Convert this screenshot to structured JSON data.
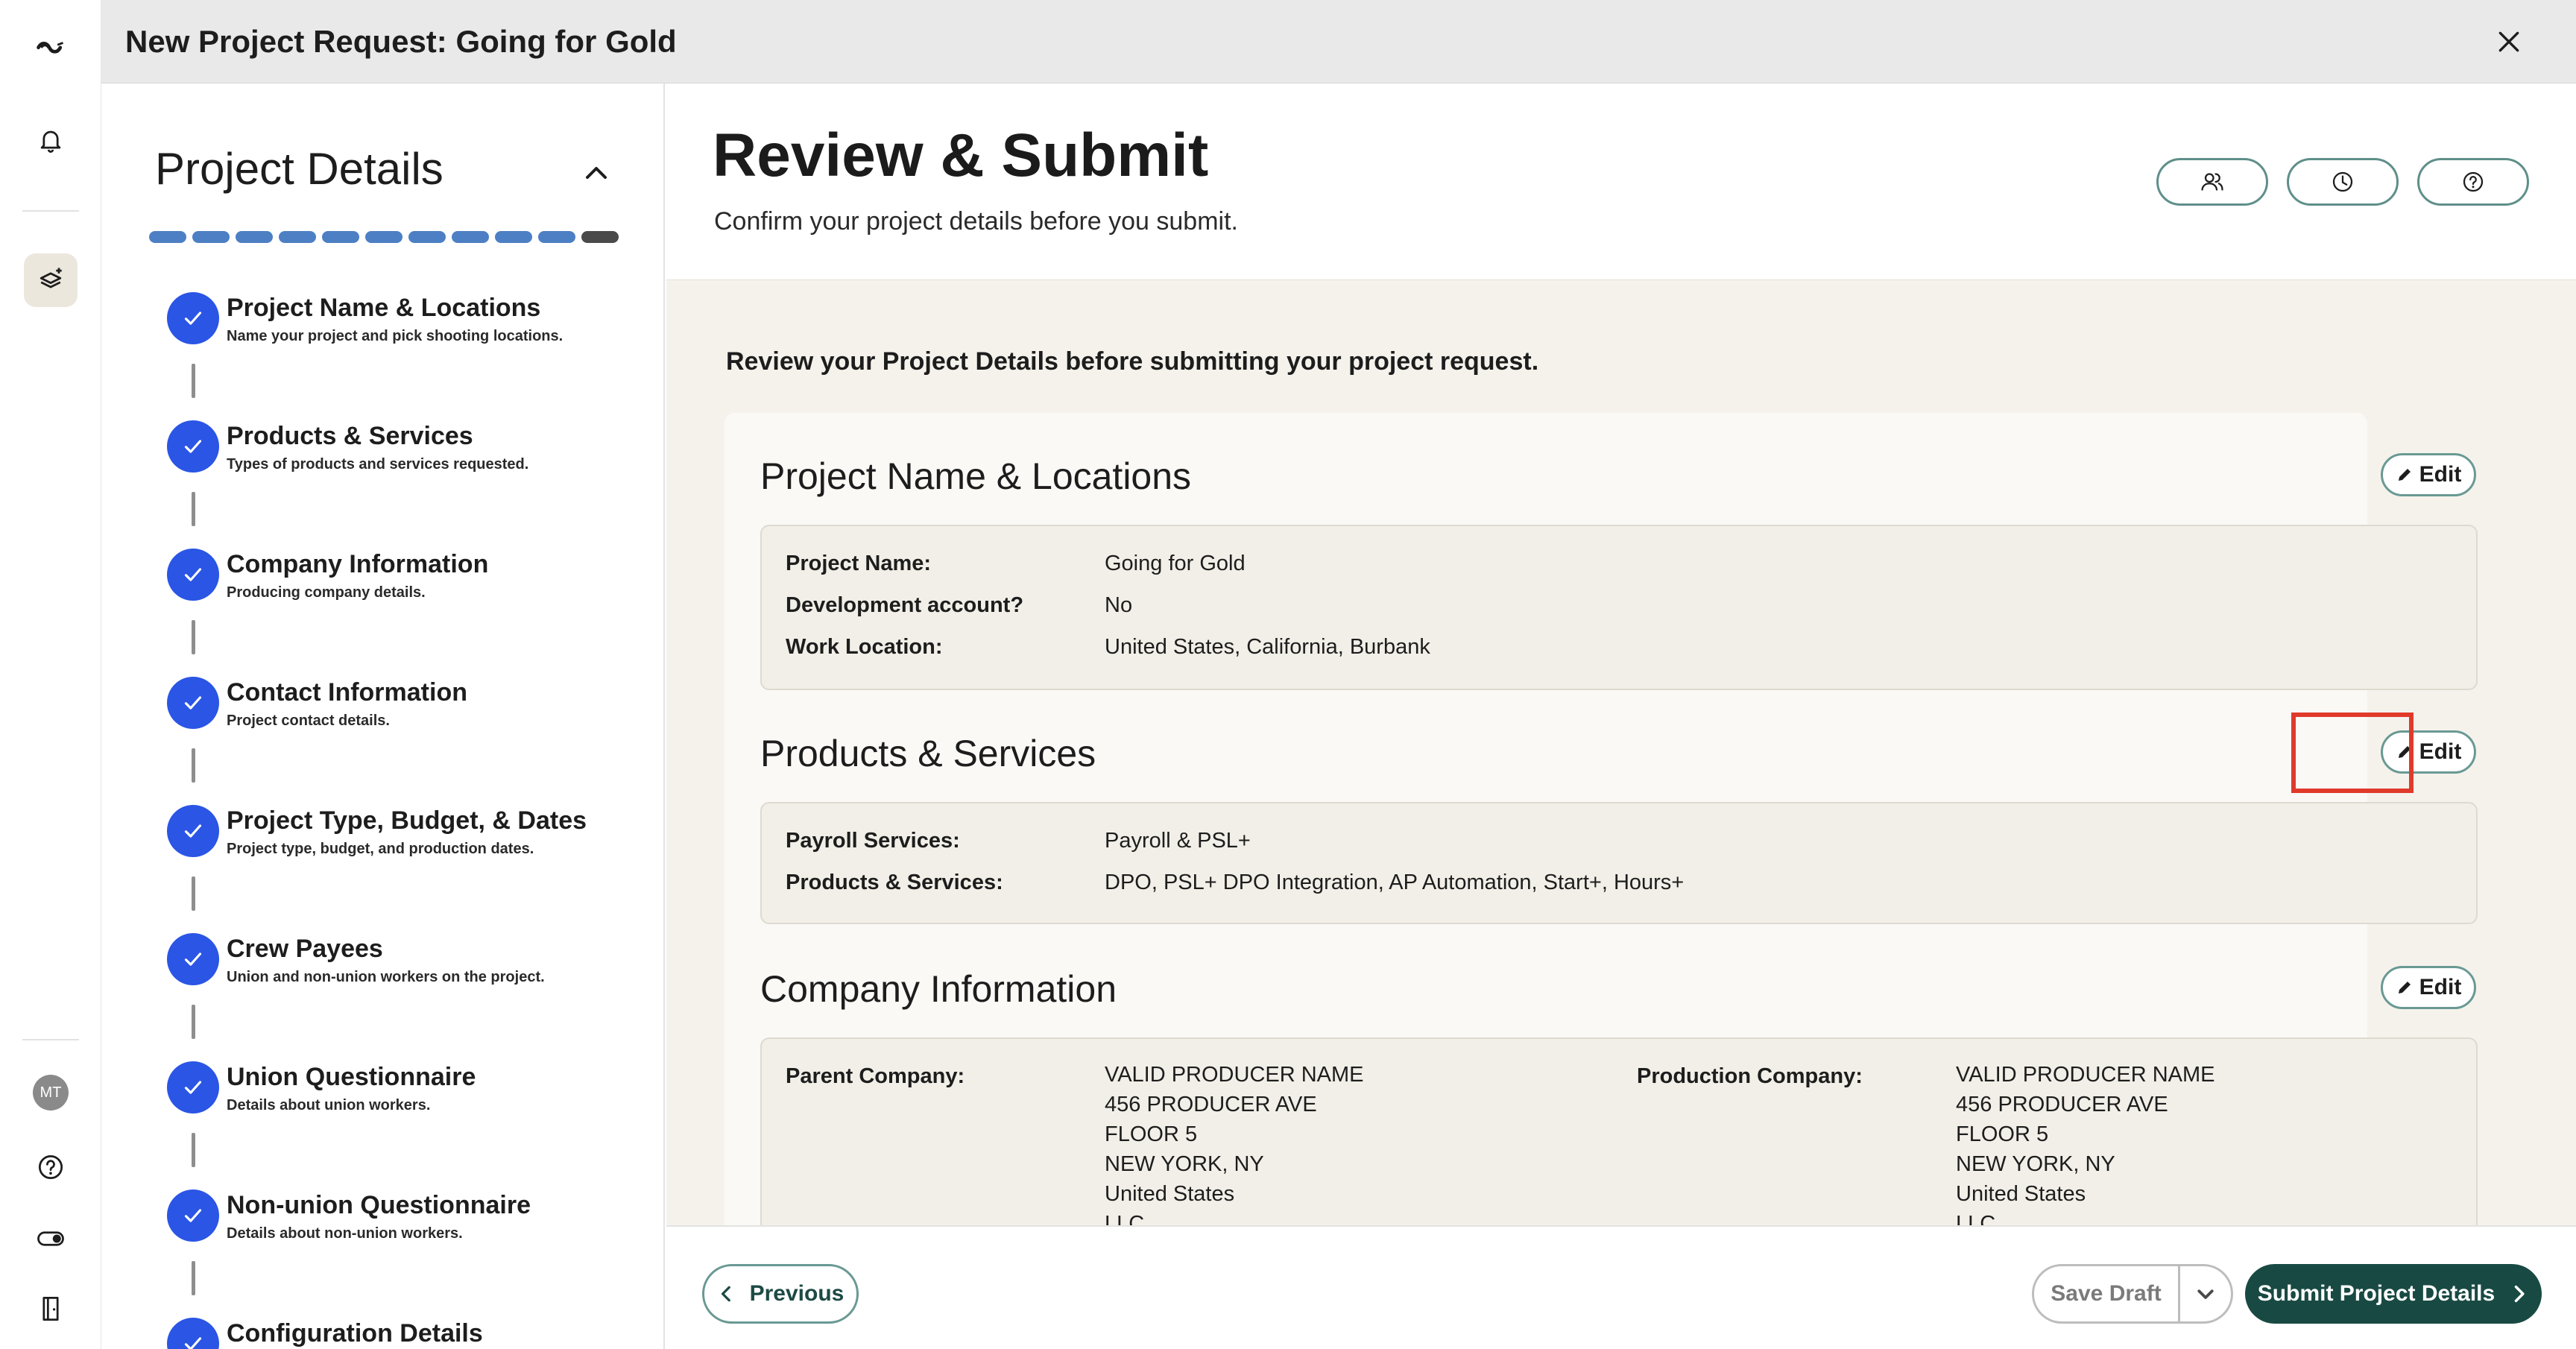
{
  "window": {
    "title": "New Project Request: Going for Gold"
  },
  "rail": {
    "avatar_initials": "MT"
  },
  "sidebar": {
    "heading": "Project Details",
    "steps": [
      {
        "label": "Project Name & Locations",
        "desc": "Name your project and pick shooting locations."
      },
      {
        "label": "Products & Services",
        "desc": "Types of products and services requested."
      },
      {
        "label": "Company Information",
        "desc": "Producing company details."
      },
      {
        "label": "Contact Information",
        "desc": "Project contact details."
      },
      {
        "label": "Project Type, Budget, & Dates",
        "desc": "Project type, budget, and production dates."
      },
      {
        "label": "Crew Payees",
        "desc": "Union and non-union workers on the project."
      },
      {
        "label": "Union Questionnaire",
        "desc": "Details about union workers."
      },
      {
        "label": "Non-union Questionnaire",
        "desc": "Details about non-union workers."
      },
      {
        "label": "Configuration Details",
        "desc": ""
      }
    ]
  },
  "main": {
    "title": "Review & Submit",
    "subtitle": "Confirm your project details before you submit.",
    "intro": "Review your Project Details before submitting your project request.",
    "edit_label": "Edit",
    "sections": {
      "project": {
        "title": "Project Name & Locations",
        "rows": [
          {
            "k": "Project Name:",
            "v": "Going for Gold"
          },
          {
            "k": "Development account?",
            "v": "No"
          },
          {
            "k": "Work Location:",
            "v": "United States, California, Burbank"
          }
        ]
      },
      "products": {
        "title": "Products & Services",
        "rows": [
          {
            "k": "Payroll Services:",
            "v": "Payroll & PSL+"
          },
          {
            "k": "Products & Services:",
            "v": "DPO, PSL+ DPO Integration, AP Automation, Start+, Hours+"
          }
        ]
      },
      "company": {
        "title": "Company Information",
        "parent_label": "Parent Company:",
        "parent_lines": [
          "VALID PRODUCER NAME",
          "456 PRODUCER AVE",
          "FLOOR 5",
          "NEW YORK, NY",
          "United States",
          "LLC"
        ],
        "production_label": "Production Company:",
        "production_lines": [
          "VALID PRODUCER NAME",
          "456 PRODUCER AVE",
          "FLOOR 5",
          "NEW YORK, NY",
          "United States",
          "LLC"
        ]
      }
    }
  },
  "footer": {
    "previous": "Previous",
    "save_draft": "Save Draft",
    "submit": "Submit Project Details"
  },
  "colors": {
    "accent_teal": "#184a43",
    "step_blue": "#2a55e5",
    "highlight_red": "#e03a2b"
  }
}
